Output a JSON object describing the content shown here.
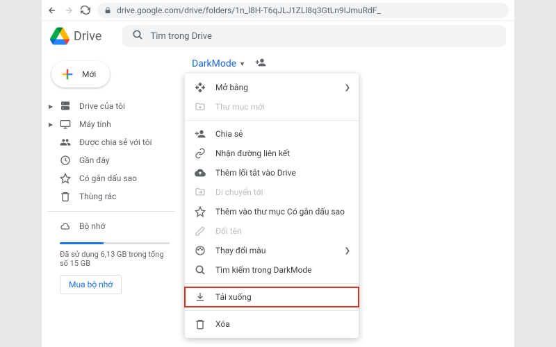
{
  "url": "drive.google.com/drive/folders/1n_l8H-T6qJLJ1ZLl8q3GtLn9IJmuRdF_",
  "app_name": "Drive",
  "search_placeholder": "Tìm trong Drive",
  "new_button": "Mới",
  "sidebar": {
    "items": [
      {
        "label": "Drive của tôi",
        "has_caret": true
      },
      {
        "label": "Máy tính",
        "has_caret": true
      },
      {
        "label": "Được chia sẻ với tôi"
      },
      {
        "label": "Gần đây"
      },
      {
        "label": "Có gắn dấu sao"
      },
      {
        "label": "Thùng rác"
      }
    ],
    "storage_label": "Bộ nhớ",
    "storage_text": "Đã sử dụng 6,13 GB trong tổng số 15 GB",
    "buy_label": "Mua bộ nhớ"
  },
  "breadcrumb": {
    "current": "DarkMode"
  },
  "context_menu": {
    "open_with": "Mở bằng",
    "new_folder": "Thư mục mới",
    "share": "Chia sẻ",
    "get_link": "Nhận đường liên kết",
    "add_shortcut": "Thêm lối tắt vào Drive",
    "move_to": "Di chuyển tới",
    "add_starred": "Thêm vào thư mục Có gắn dấu sao",
    "rename": "Đổi tên",
    "change_color": "Thay đổi màu",
    "search_in": "Tìm kiếm trong DarkMode",
    "download": "Tải xuống",
    "delete": "Xóa"
  }
}
